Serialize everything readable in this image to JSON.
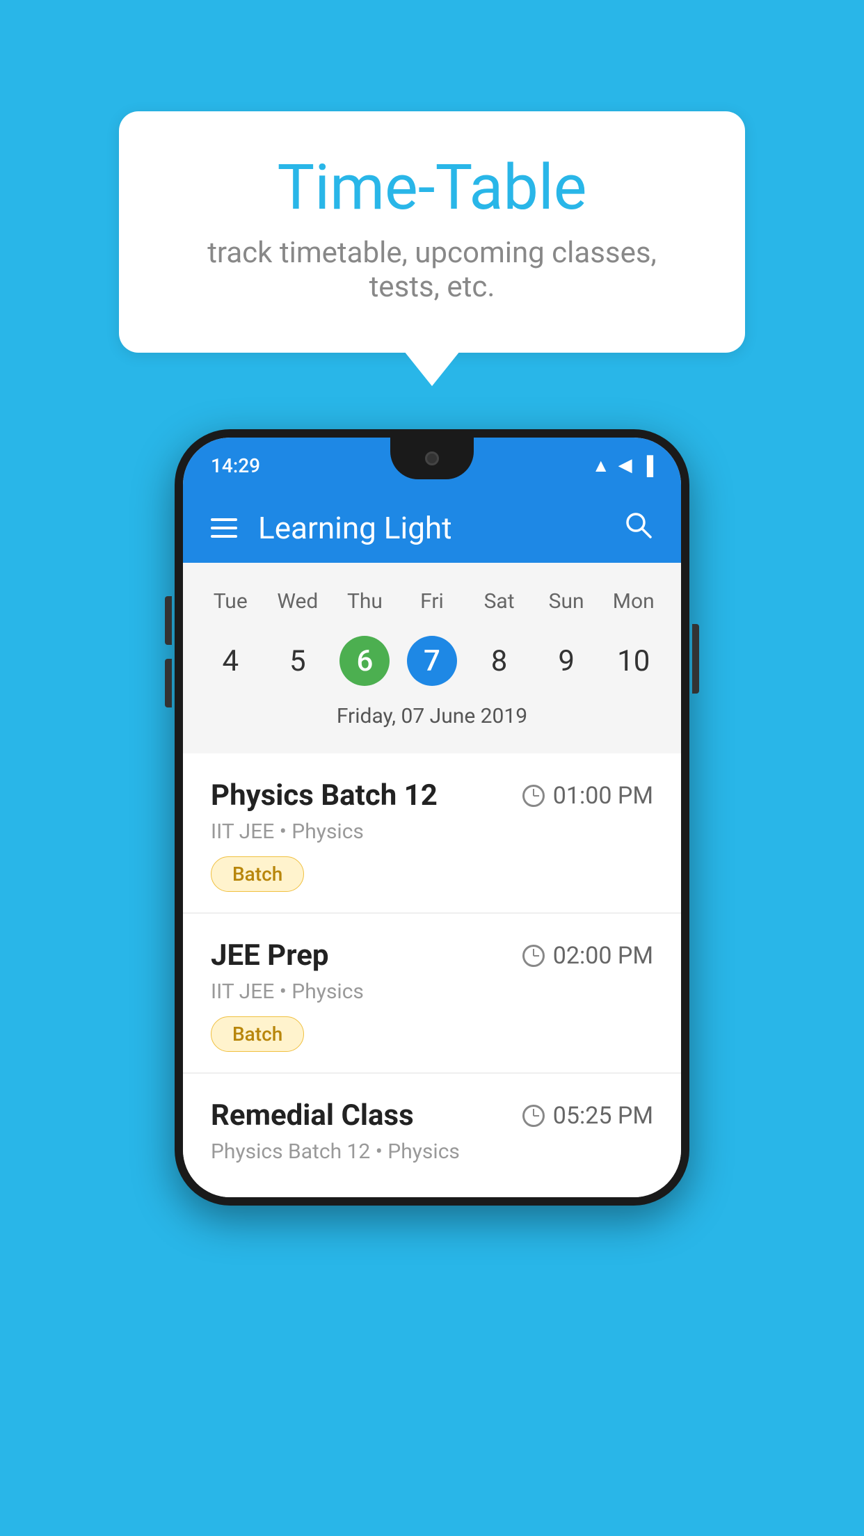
{
  "background_color": "#29B6E8",
  "bubble": {
    "title": "Time-Table",
    "subtitle": "track timetable, upcoming classes, tests, etc."
  },
  "phone": {
    "status_bar": {
      "time": "14:29",
      "wifi": "▲",
      "signal": "▲",
      "battery": "▐"
    },
    "app_bar": {
      "title": "Learning Light",
      "menu_icon": "menu",
      "search_icon": "search"
    },
    "calendar": {
      "days": [
        "Tue",
        "Wed",
        "Thu",
        "Fri",
        "Sat",
        "Sun",
        "Mon"
      ],
      "dates": [
        "4",
        "5",
        "6",
        "7",
        "8",
        "9",
        "10"
      ],
      "today_index": 2,
      "selected_index": 3,
      "selected_label": "Friday, 07 June 2019"
    },
    "schedule": [
      {
        "title": "Physics Batch 12",
        "time": "01:00 PM",
        "meta": "IIT JEE • Physics",
        "badge": "Batch"
      },
      {
        "title": "JEE Prep",
        "time": "02:00 PM",
        "meta": "IIT JEE • Physics",
        "badge": "Batch"
      },
      {
        "title": "Remedial Class",
        "time": "05:25 PM",
        "meta": "Physics Batch 12 • Physics",
        "badge": ""
      }
    ]
  }
}
